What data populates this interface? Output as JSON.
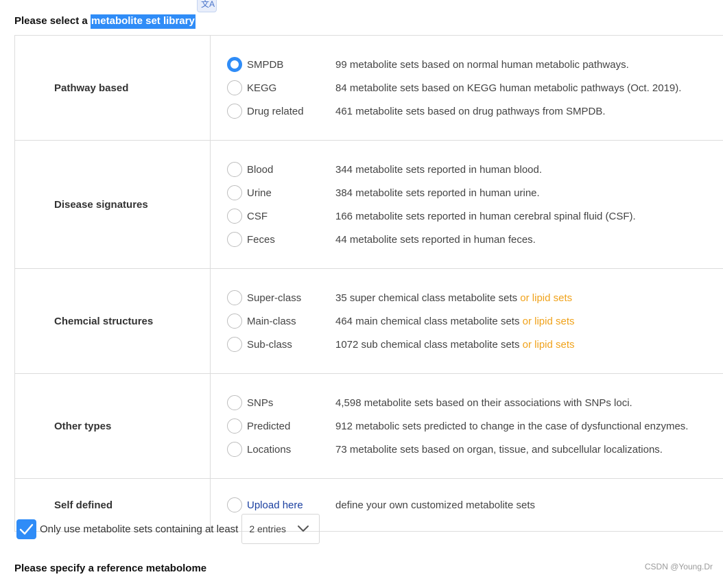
{
  "heading": {
    "prefix": "Please select a ",
    "highlight": "metabolite set library"
  },
  "categories": [
    {
      "label": "Pathway based",
      "options": [
        {
          "label": "SMPDB",
          "desc": "99 metabolite sets based on normal human metabolic pathways.",
          "checked": true
        },
        {
          "label": "KEGG",
          "desc": "84 metabolite sets based on KEGG human metabolic pathways (Oct. 2019).",
          "checked": false
        },
        {
          "label": "Drug related",
          "desc": "461 metabolite sets based on drug pathways from SMPDB.",
          "checked": false
        }
      ]
    },
    {
      "label": "Disease signatures",
      "options": [
        {
          "label": "Blood",
          "desc": "344 metabolite sets reported in human blood.",
          "checked": false
        },
        {
          "label": "Urine",
          "desc": "384 metabolite sets reported in human urine.",
          "checked": false
        },
        {
          "label": "CSF",
          "desc": "166 metabolite sets reported in human cerebral spinal fluid (CSF).",
          "checked": false
        },
        {
          "label": "Feces",
          "desc": "44 metabolite sets reported in human feces.",
          "checked": false
        }
      ]
    },
    {
      "label": "Chemcial structures",
      "options": [
        {
          "label": "Super-class",
          "desc": "35 super chemical class metabolite sets",
          "lipid": "or lipid sets",
          "checked": false
        },
        {
          "label": "Main-class",
          "desc": "464 main chemical class metabolite sets",
          "lipid": "or lipid sets",
          "checked": false
        },
        {
          "label": "Sub-class",
          "desc": "1072 sub chemical class metabolite sets",
          "lipid": "or lipid sets",
          "checked": false
        }
      ]
    },
    {
      "label": "Other types",
      "options": [
        {
          "label": "SNPs",
          "desc": "4,598 metabolite sets based on their associations with SNPs loci.",
          "checked": false
        },
        {
          "label": "Predicted",
          "desc": "912 metabolic sets predicted to change in the case of dysfunctional enzymes.",
          "checked": false
        },
        {
          "label": "Locations",
          "desc": "73 metabolite sets based on organ, tissue, and subcellular localizations.",
          "checked": false
        }
      ]
    },
    {
      "label": "Self defined",
      "options": [
        {
          "label": "Upload here",
          "desc": "define your own customized metabolite sets",
          "checked": false,
          "link": true
        }
      ]
    }
  ],
  "filter": {
    "checked": true,
    "label": "Only use metabolite sets containing at least",
    "select_value": "2 entries"
  },
  "heading2": "Please specify a reference metabolome",
  "watermark": "CSDN @Young.Dr",
  "colors": {
    "accent": "#2f8cf7",
    "lipid_link": "#f0a21a",
    "upload_link": "#1a3fa0"
  },
  "icons": {
    "translate": "translate-icon",
    "checkbox": "checkmark-icon",
    "dropdown": "chevron-down-icon"
  }
}
